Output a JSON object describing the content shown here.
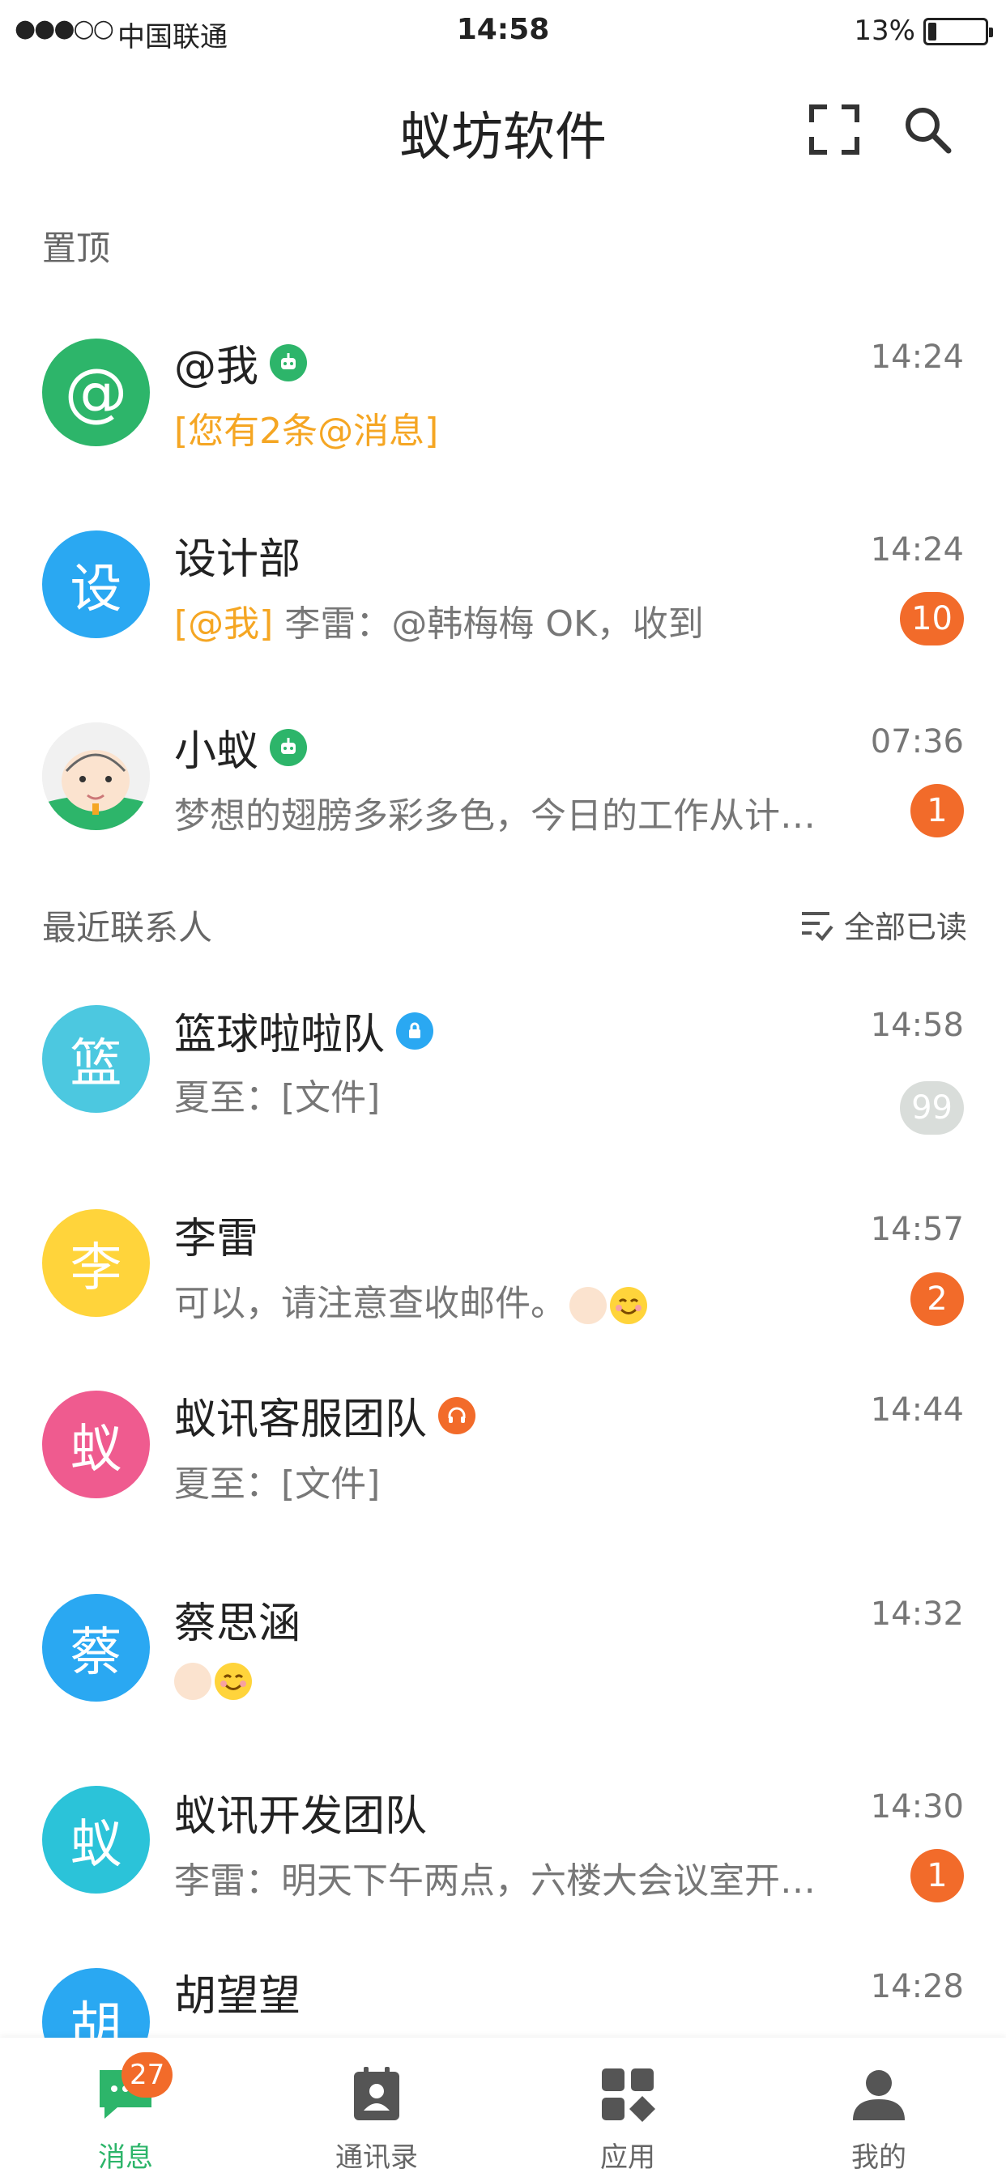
{
  "status_bar": {
    "signal": "●●●○○",
    "carrier": "中国联通",
    "time": "14:58",
    "battery_pct": "13%",
    "battery_level": 0.13
  },
  "header": {
    "title": "蚁坊软件",
    "scan_icon": "scan-icon",
    "search_icon": "search-icon"
  },
  "pinned": {
    "label": "置顶",
    "items": [
      {
        "name": "@我",
        "time": "14:24",
        "preview_hl": "[您有2条@消息]",
        "preview": "",
        "avatar_text": "@",
        "avatar_color": "#2db56a",
        "tag": "robot-icon",
        "tag_color": "#2db56a"
      },
      {
        "name": "设计部",
        "time": "14:24",
        "preview_hl": "[@我]",
        "preview": " 李雷：@韩梅梅 OK，收到",
        "avatar_text": "设",
        "avatar_color": "#2aa8f2",
        "badge": "10"
      },
      {
        "name": "小蚁",
        "time": "07:36",
        "preview": "梦想的翅膀多彩多色，今日的工作从计…",
        "avatar_color": "#eeeeee",
        "tag": "robot-icon",
        "tag_color": "#2db56a",
        "badge": "1"
      }
    ]
  },
  "recent": {
    "label": "最近联系人",
    "mark_all_read": "全部已读",
    "items": [
      {
        "name": "篮球啦啦队",
        "time": "14:58",
        "preview": "夏至：[文件]",
        "avatar_text": "篮",
        "avatar_color": "#4cc8e0",
        "tag": "lock-icon",
        "tag_color": "#2aa8f2",
        "badge": "99",
        "badge_muted": true
      },
      {
        "name": "李雷",
        "time": "14:57",
        "preview": "可以，请注意查收邮件。",
        "avatar_text": "李",
        "avatar_color": "#ffd43b",
        "badge": "2"
      },
      {
        "name": "蚁讯客服团队",
        "time": "14:44",
        "preview": "夏至：[文件]",
        "avatar_text": "蚁",
        "avatar_color": "#ef5b8f",
        "tag": "headset-icon",
        "tag_color": "#f26b2a"
      },
      {
        "name": "蔡思涵",
        "time": "14:32",
        "preview": "",
        "avatar_text": "蔡",
        "avatar_color": "#2aa8f2"
      },
      {
        "name": "蚁讯开发团队",
        "time": "14:30",
        "preview": "李雷：明天下午两点，六楼大会议室开…",
        "avatar_text": "蚁",
        "avatar_color": "#2bc3d9",
        "badge": "1"
      },
      {
        "name": "胡望望",
        "time": "14:28",
        "preview": "",
        "avatar_text": "胡",
        "avatar_color": "#2aa8f2"
      }
    ]
  },
  "tabs": [
    {
      "label": "消息",
      "icon": "chat-icon",
      "badge": "27",
      "active": true
    },
    {
      "label": "通讯录",
      "icon": "contacts-icon"
    },
    {
      "label": "应用",
      "icon": "apps-icon"
    },
    {
      "label": "我的",
      "icon": "profile-icon"
    }
  ],
  "colors": {
    "accent": "#2db56a",
    "badge": "#f26b2a",
    "highlight": "#f5a623"
  }
}
